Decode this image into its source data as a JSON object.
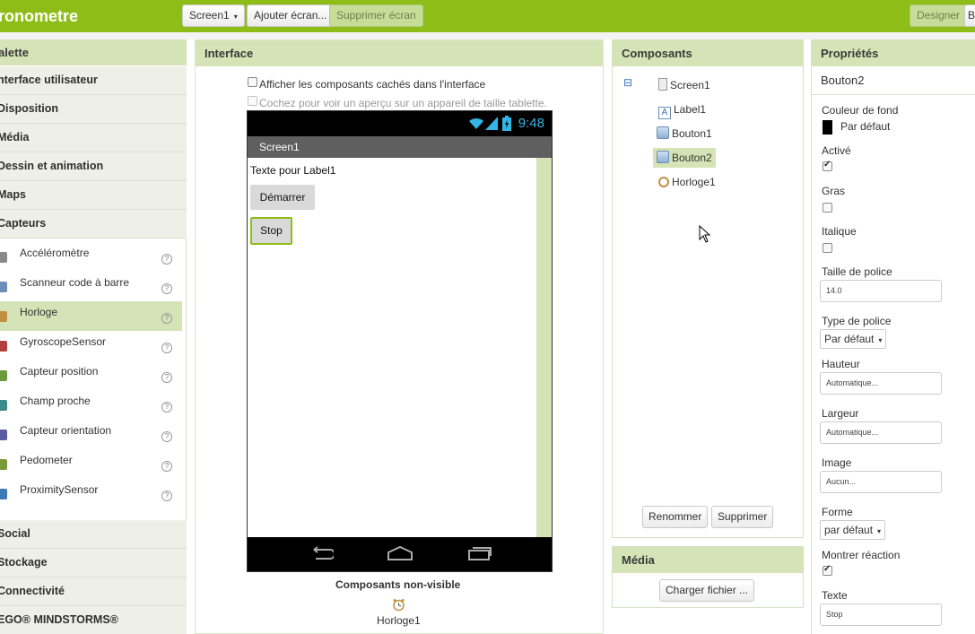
{
  "header": {
    "app_title": "ronometre",
    "screen_select": "Screen1",
    "add_screen": "Ajouter écran...",
    "remove_screen": "Supprimer écran",
    "designer": "Designer",
    "blocks_partial": "B"
  },
  "palette": {
    "title": "alette",
    "categories_top": [
      "nterface utilisateur",
      "Disposition",
      "Média",
      "Dessin et animation",
      "Maps",
      "Capteurs"
    ],
    "items": [
      {
        "label": "Accéléromètre",
        "icon": "accelerometer-icon"
      },
      {
        "label": "Scanneur code à barre",
        "icon": "barcode-icon"
      },
      {
        "label": "Horloge",
        "icon": "clock-icon",
        "selected": true
      },
      {
        "label": "GyroscopeSensor",
        "icon": "gyroscope-icon"
      },
      {
        "label": "Capteur position",
        "icon": "location-icon"
      },
      {
        "label": "Champ proche",
        "icon": "nfc-icon"
      },
      {
        "label": "Capteur orientation",
        "icon": "orientation-icon"
      },
      {
        "label": "Pedometer",
        "icon": "pedometer-icon"
      },
      {
        "label": "ProximitySensor",
        "icon": "proximity-icon"
      }
    ],
    "help_glyph": "?",
    "categories_bottom": [
      "Social",
      "Stockage",
      "Connectivité",
      "EGO® MINDSTORMS®"
    ]
  },
  "viewer": {
    "title": "Interface",
    "show_hidden": "Afficher les composants cachés dans l'interface",
    "tablet_preview": "Cochez pour voir un aperçu sur un appareil de taille tablette.",
    "phone": {
      "time": "9:48",
      "screen_title": "Screen1",
      "label1_text": "Texte pour Label1",
      "button1_text": "Démarrer",
      "button2_text": "Stop"
    },
    "nonvisible_title": "Composants non-visible",
    "nonvisible_items": [
      "Horloge1"
    ]
  },
  "components": {
    "title": "Composants",
    "collapse_glyph": "⊟",
    "tree": [
      {
        "label": "Screen1",
        "icon": "screen-icon"
      },
      {
        "label": "Label1",
        "icon": "label-icon"
      },
      {
        "label": "Bouton1",
        "icon": "button-icon"
      },
      {
        "label": "Bouton2",
        "icon": "button-icon",
        "selected": true
      },
      {
        "label": "Horloge1",
        "icon": "clock-icon"
      }
    ],
    "rename": "Renommer",
    "delete": "Supprimer"
  },
  "media": {
    "title": "Média",
    "upload": "Charger fichier ..."
  },
  "properties": {
    "title": "Propriétés",
    "selected_component": "Bouton2",
    "bg_color_label": "Couleur de fond",
    "bg_color_value": "Par défaut",
    "enabled_label": "Activé",
    "enabled": true,
    "bold_label": "Gras",
    "bold": false,
    "italic_label": "Italique",
    "italic": false,
    "font_size_label": "Taille de police",
    "font_size_value": "14.0",
    "font_type_label": "Type de police",
    "font_type_value": "Par défaut",
    "height_label": "Hauteur",
    "height_value": "Automatique...",
    "width_label": "Largeur",
    "width_value": "Automatique...",
    "image_label": "Image",
    "image_value": "Aucun...",
    "shape_label": "Forme",
    "shape_value": "par défaut",
    "feedback_label": "Montrer réaction",
    "feedback": true,
    "text_label": "Texte",
    "text_value": "Stop"
  },
  "colors": {
    "accent": "#8fbd18",
    "panel_header": "#d5e4b6",
    "selection": "#d5e4b6",
    "clock_blue": "#33b5e5"
  }
}
